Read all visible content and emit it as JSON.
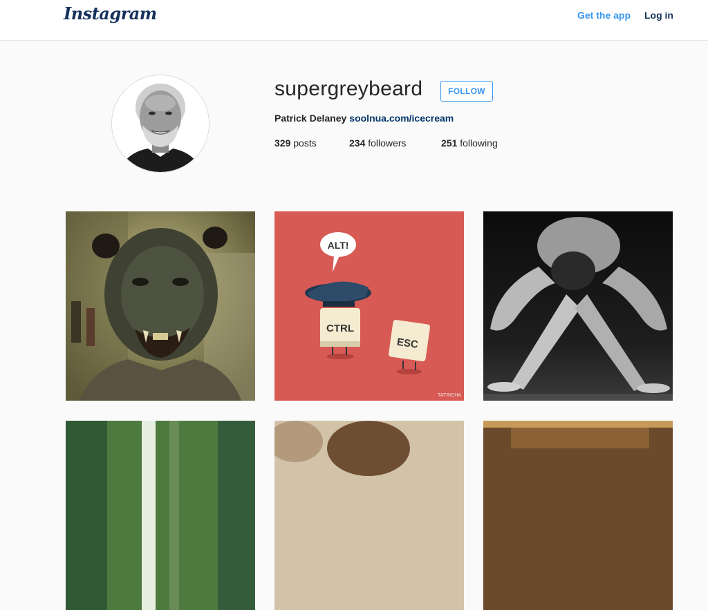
{
  "header": {
    "logo_text": "Instagram",
    "get_app_label": "Get the app",
    "login_label": "Log in",
    "colors": {
      "link_blue": "#3897f0",
      "dark_blue": "#16325c"
    }
  },
  "profile": {
    "username": "supergreybeard",
    "follow_label": "FOLLOW",
    "full_name": "Patrick Delaney",
    "website": "soolnua.com/icecream",
    "posts_count": "329",
    "posts_label": "posts",
    "followers_count": "234",
    "followers_label": "followers",
    "following_count": "251",
    "following_label": "following"
  },
  "posts": {
    "post2_bubble_text": "ALT!",
    "post2_key1_text": "CTRL",
    "post2_key2_text": "ESC",
    "post2_signature": "TATRICHA"
  }
}
